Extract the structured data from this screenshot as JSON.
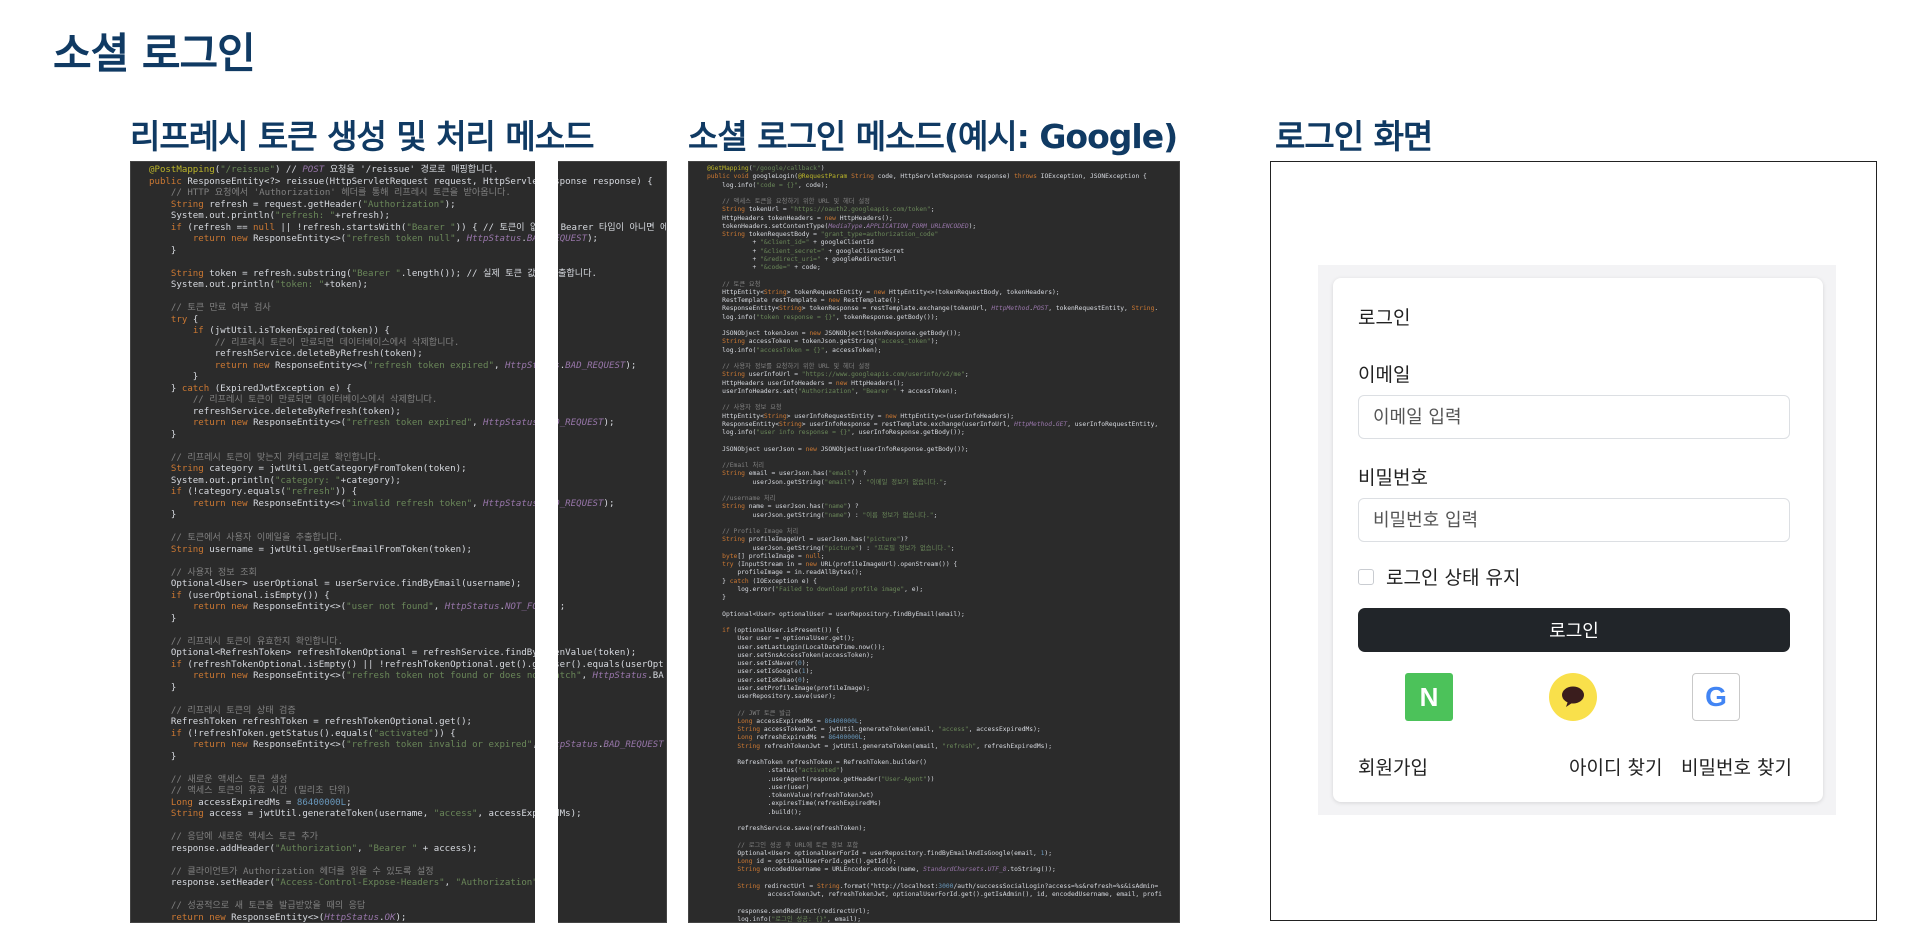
{
  "page": {
    "title": "소셜 로그인"
  },
  "sections": {
    "refresh_title": "리프레시 토큰 생성 및 처리 메소드",
    "social_title": "소셜 로그인 메소드(예시: Google)",
    "login_title": "로그인 화면"
  },
  "login_form": {
    "heading": "로그인",
    "email_label": "이메일",
    "email_placeholder": "이메일 입력",
    "email_value": "",
    "password_label": "비밀번호",
    "password_placeholder": "비밀번호 입력",
    "password_value": "",
    "remember_label": "로그인 상태 유지",
    "remember_checked": false,
    "submit_label": "로그인",
    "social_buttons": [
      {
        "icon": "naver-icon",
        "glyph": "N"
      },
      {
        "icon": "kakao-icon"
      },
      {
        "icon": "google-icon",
        "glyph": "G"
      }
    ],
    "signup_label": "회원가입",
    "find_id_label": "아이디 찾기",
    "find_password_label": "비밀번호 찾기"
  },
  "colors": {
    "title": "#103a63",
    "code_background": "#2b2b2b",
    "login_button": "#212529",
    "naver": "#4cc25a",
    "kakao": "#f9e04b",
    "google_blue": "#4285f4"
  },
  "code": {
    "refresh_method": [
      "@PostMapping(\"/reissue\") // POST 요청을 '/reissue' 경로로 매핑합니다.",
      "public ResponseEntity<?> reissue(HttpServletRequest request, HttpServletResponse response) {",
      "    // HTTP 요청에서 'Authorization' 헤더를 통해 리프레시 토큰을 받아옵니다.",
      "    String refresh = request.getHeader(\"Authorization\");",
      "    System.out.println(\"refresh: \"+refresh);",
      "    if (refresh == null || !refresh.startsWith(\"Bearer \")) { // 토큰이 없거나 Bearer 타입이 아니면 에",
      "        return new ResponseEntity<>(\"refresh token null\", HttpStatus.BAD_REQUEST);",
      "    }",
      "",
      "    String token = refresh.substring(\"Bearer \".length()); // 실제 토큰 값을 추출합니다.",
      "    System.out.println(\"token: \"+token);",
      "",
      "    // 토큰 만료 여부 검사",
      "    try {",
      "        if (jwtUtil.isTokenExpired(token)) {",
      "            // 리프레시 토큰이 만료되면 데이터베이스에서 삭제합니다.",
      "            refreshService.deleteByRefresh(token);",
      "            return new ResponseEntity<>(\"refresh token expired\", HttpStatus.BAD_REQUEST);",
      "        }",
      "    } catch (ExpiredJwtException e) {",
      "        // 리프레시 토큰이 만료되면 데이터베이스에서 삭제합니다.",
      "        refreshService.deleteByRefresh(token);",
      "        return new ResponseEntity<>(\"refresh token expired\", HttpStatus.BAD_REQUEST);",
      "    }",
      "",
      "    // 리프레시 토큰이 맞는지 카테고리로 확인합니다.",
      "    String category = jwtUtil.getCategoryFromToken(token);",
      "    System.out.println(\"category: \"+category);",
      "    if (!category.equals(\"refresh\")) {",
      "        return new ResponseEntity<>(\"invalid refresh token\", HttpStatus.BAD_REQUEST);",
      "    }",
      "",
      "    // 토큰에서 사용자 이메일을 추출합니다.",
      "    String username = jwtUtil.getUserEmailFromToken(token);",
      "",
      "    // 사용자 정보 조회",
      "    Optional<User> userOptional = userService.findByEmail(username);",
      "    if (userOptional.isEmpty()) {",
      "        return new ResponseEntity<>(\"user not found\", HttpStatus.NOT_FOUND);",
      "    }",
      "",
      "    // 리프레시 토큰이 유효한지 확인합니다.",
      "    Optional<RefreshToken> refreshTokenOptional = refreshService.findByTokenValue(token);",
      "    if (refreshTokenOptional.isEmpty() || !refreshTokenOptional.get().getUser().equals(userOpt",
      "        return new ResponseEntity<>(\"refresh token not found or does not match\", HttpStatus.BA",
      "    }",
      "",
      "    // 리프레시 토큰의 상태 검증",
      "    RefreshToken refreshToken = refreshTokenOptional.get();",
      "    if (!refreshToken.getStatus().equals(\"activated\")) {",
      "        return new ResponseEntity<>(\"refresh token invalid or expired\", HttpStatus.BAD_REQUEST",
      "    }",
      "",
      "    // 새로운 액세스 토큰 생성",
      "    // 액세스 토큰의 유효 시간 (밀리초 단위)",
      "    Long accessExpiredMs = 86400000L;",
      "    String access = jwtUtil.generateToken(username, \"access\", accessExpiredMs);",
      "",
      "    // 응답에 새로운 액세스 토큰 추가",
      "    response.addHeader(\"Authorization\", \"Bearer \" + access);",
      "",
      "    // 클라이언트가 Authorization 헤더를 읽을 수 있도록 설정",
      "    response.setHeader(\"Access-Control-Expose-Headers\", \"Authorization\");",
      "",
      "    // 성공적으로 새 토큰을 발급받았을 때의 응답",
      "    return new ResponseEntity<>(HttpStatus.OK);",
      "}"
    ],
    "google_method": [
      "@GetMapping(\"/google/callback\")",
      "public void googleLogin(@RequestParam String code, HttpServletResponse response) throws IOException, JSONException {",
      "    log.info(\"code = {}\", code);",
      "",
      "    // 액세스 토큰을 요청하기 위한 URL 및 헤더 설정",
      "    String tokenUrl = \"https://oauth2.googleapis.com/token\";",
      "    HttpHeaders tokenHeaders = new HttpHeaders();",
      "    tokenHeaders.setContentType(MediaType.APPLICATION_FORM_URLENCODED);",
      "    String tokenRequestBody = \"grant_type=authorization_code\"",
      "            + \"&client_id=\" + googleClientId",
      "            + \"&client_secret=\" + googleClientSecret",
      "            + \"&redirect_uri=\" + googleRedirectUrl",
      "            + \"&code=\" + code;",
      "",
      "    // 토큰 요청",
      "    HttpEntity<String> tokenRequestEntity = new HttpEntity<>(tokenRequestBody, tokenHeaders);",
      "    RestTemplate restTemplate = new RestTemplate();",
      "    ResponseEntity<String> tokenResponse = restTemplate.exchange(tokenUrl, HttpMethod.POST, tokenRequestEntity, String.",
      "    log.info(\"token response = {}\", tokenResponse.getBody());",
      "",
      "    JSONObject tokenJson = new JSONObject(tokenResponse.getBody());",
      "    String accessToken = tokenJson.getString(\"access_token\");",
      "    log.info(\"accessToken = {}\", accessToken);",
      "",
      "    // 사용자 정보를 요청하기 위한 URL 및 헤더 설정",
      "    String userInfoUrl = \"https://www.googleapis.com/userinfo/v2/me\";",
      "    HttpHeaders userInfoHeaders = new HttpHeaders();",
      "    userInfoHeaders.set(\"Authorization\", \"Bearer \" + accessToken);",
      "",
      "    // 사용자 정보 요청",
      "    HttpEntity<String> userInfoRequestEntity = new HttpEntity<>(userInfoHeaders);",
      "    ResponseEntity<String> userInfoResponse = restTemplate.exchange(userInfoUrl, HttpMethod.GET, userInfoRequestEntity,",
      "    log.info(\"user info response = {}\", userInfoResponse.getBody());",
      "",
      "    JSONObject userJson = new JSONObject(userInfoResponse.getBody());",
      "",
      "    //Email 처리",
      "    String email = userJson.has(\"email\") ?",
      "            userJson.getString(\"email\") : \"이메일 정보가 없습니다.\";",
      "",
      "    //username 처리",
      "    String name = userJson.has(\"name\") ?",
      "            userJson.getString(\"name\") : \"이름 정보가 없습니다.\";",
      "",
      "    // Profile Image 처리",
      "    String profileImageUrl = userJson.has(\"picture\")?",
      "            userJson.getString(\"picture\") : \"프로필 정보가 없습니다.\";",
      "    byte[] profileImage = null;",
      "    try (InputStream in = new URL(profileImageUrl).openStream()) {",
      "        profileImage = in.readAllBytes();",
      "    } catch (IOException e) {",
      "        log.error(\"Failed to download profile image\", e);",
      "    }",
      "",
      "    Optional<User> optionalUser = userRepository.findByEmail(email);",
      "",
      "    if (optionalUser.isPresent()) {",
      "        User user = optionalUser.get();",
      "        user.setLastLogin(LocalDateTime.now());",
      "        user.setSnsAccessToken(accessToken);",
      "        user.setIsNaver(0);",
      "        user.setIsGoogle(1);",
      "        user.setIsKakao(0);",
      "        user.setProfileImage(profileImage);",
      "        userRepository.save(user);",
      "",
      "        // JWT 토큰 발급",
      "        Long accessExpiredMs = 86400000L;",
      "        String accessTokenJwt = jwtUtil.generateToken(email, \"access\", accessExpiredMs);",
      "        Long refreshExpiredMs = 86400000L;",
      "        String refreshTokenJwt = jwtUtil.generateToken(email, \"refresh\", refreshExpiredMs);",
      "",
      "        RefreshToken refreshToken = RefreshToken.builder()",
      "                .status(\"activated\")",
      "                .userAgent(response.getHeader(\"User-Agent\"))",
      "                .user(user)",
      "                .tokenValue(refreshTokenJwt)",
      "                .expiresTime(refreshExpiredMs)",
      "                .build();",
      "",
      "        refreshService.save(refreshToken);",
      "",
      "        // 로그인 성공 후 URL에 토큰 정보 포함",
      "        Optional<User> optionalUserForId = userRepository.findByEmailAndIsGoogle(email, 1);",
      "        Long id = optionalUserForId.get().getId();",
      "        String encodedUsername = URLEncoder.encode(name, StandardCharsets.UTF_8.toString());",
      "",
      "        String redirectUrl = String.format(\"http://localhost:3000/auth/successSocialLogin?access=%s&refresh=%s&isAdmin=",
      "                accessTokenJwt, refreshTokenJwt, optionalUserForId.get().getIsAdmin(), id, encodedUsername, email, profi",
      "",
      "        response.sendRedirect(redirectUrl);",
      "        log.info(\"로그인 성공: {}\", email);"
    ]
  }
}
